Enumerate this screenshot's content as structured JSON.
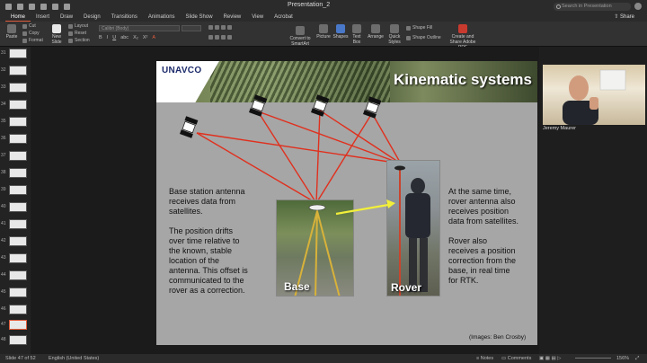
{
  "window": {
    "title": "Presentation_2",
    "search_placeholder": "Search in Presentation"
  },
  "tabs": [
    {
      "label": "Home",
      "active": true
    },
    {
      "label": "Insert"
    },
    {
      "label": "Draw"
    },
    {
      "label": "Design"
    },
    {
      "label": "Transitions"
    },
    {
      "label": "Animations"
    },
    {
      "label": "Slide Show"
    },
    {
      "label": "Review"
    },
    {
      "label": "View"
    },
    {
      "label": "Acrobat"
    }
  ],
  "share_label": "Share",
  "ribbon": {
    "paste": "Paste",
    "cut": "Cut",
    "copy": "Copy",
    "format": "Format",
    "new_slide": "New Slide",
    "layout": "Layout",
    "reset": "Reset",
    "section": "Section",
    "font_placeholder": "Calibri (Body)",
    "convert_smartart": "Convert to SmartArt",
    "picture": "Picture",
    "shapes": "Shapes",
    "text_box": "Text Box",
    "arrange": "Arrange",
    "quick_styles": "Quick Styles",
    "shape_fill": "Shape Fill",
    "shape_outline": "Shape Outline",
    "create_pdf": "Create and Share Adobe PDF"
  },
  "slide_numbers": [
    "31",
    "32",
    "33",
    "34",
    "35",
    "36",
    "37",
    "38",
    "39",
    "40",
    "41",
    "42",
    "43",
    "44",
    "45",
    "46",
    "47",
    "48"
  ],
  "selected_slide": "47",
  "slide": {
    "logo": "UNAVCO",
    "title": "Kinematic systems",
    "base_text": [
      "Base station antenna",
      "receives data from",
      "satellites.",
      "",
      "The position drifts",
      "over time relative to",
      "the known, stable",
      "location of the",
      "antenna.  This offset is",
      "communicated to the",
      "rover as a correction."
    ],
    "rover_text": [
      "At the same time,",
      "rover antenna also",
      "receives position",
      "data from satellites.",
      "",
      "Rover also",
      "receives a position",
      "correction from the",
      "base, in real time",
      "for RTK."
    ],
    "base_label": "Base",
    "rover_label": "Rover",
    "credit": "(Images: Ben Crosby)",
    "colors": {
      "signal": "#e0301e",
      "correction": "#f2ef3a"
    }
  },
  "webcam": {
    "name": "Jeremy Maurer"
  },
  "status": {
    "slide_info": "Slide 47 of 52",
    "language": "English (United States)",
    "notes": "Notes",
    "comments": "Comments",
    "zoom": "156%"
  }
}
